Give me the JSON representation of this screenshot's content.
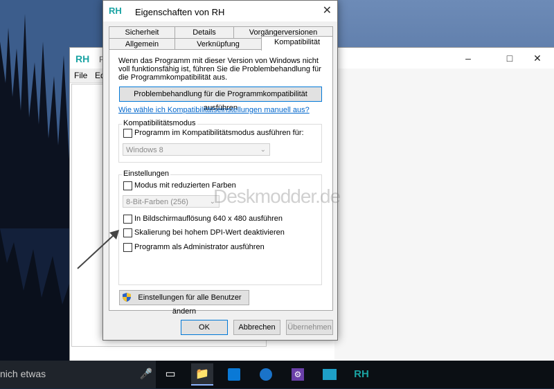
{
  "taskbar": {
    "search_text": "nich etwas",
    "icons": [
      "microphone-icon",
      "task-view-icon",
      "file-explorer-icon",
      "store-icon",
      "edge-icon",
      "settings-icon",
      "photos-icon",
      "rh-icon"
    ],
    "rh_label": "RH"
  },
  "background_window": {
    "app_icon": "RH",
    "title_partial": "R",
    "menu": [
      "File",
      "Ed"
    ]
  },
  "dialog": {
    "icon": "RH",
    "title": "Eigenschaften von RH",
    "tabs_row1": [
      "Sicherheit",
      "Details",
      "Vorgängerversionen"
    ],
    "tabs_row2": [
      "Allgemein",
      "Verknüpfung",
      "Kompatibilität"
    ],
    "intro": "Wenn das Programm mit dieser Version von Windows nicht voll funktionsfähig ist, führen Sie die Problembehandlung für die Programmkompatibilität aus.",
    "troubleshoot_button": "Problembehandlung für die Programmkompatibilität ausführen",
    "manual_link": "Wie wähle ich Kompatibilitätseinstellungen manuell aus?",
    "compat_mode": {
      "label": "Kompatibilitätsmodus",
      "checkbox": "Programm im Kompatibilitätsmodus ausführen für:",
      "select_value": "Windows 8"
    },
    "settings": {
      "label": "Einstellungen",
      "reduced_colors": "Modus mit reduzierten Farben",
      "color_select": "8-Bit-Farben (256)",
      "resolution": "In Bildschirmauflösung 640 x 480 ausführen",
      "dpi": "Skalierung bei hohem DPI-Wert deaktivieren",
      "admin": "Programm als Administrator ausführen"
    },
    "all_users_button": "Einstellungen für alle Benutzer ändern",
    "ok": "OK",
    "cancel": "Abbrechen",
    "apply": "Übernehmen"
  },
  "watermark": "Deskmodder.de"
}
